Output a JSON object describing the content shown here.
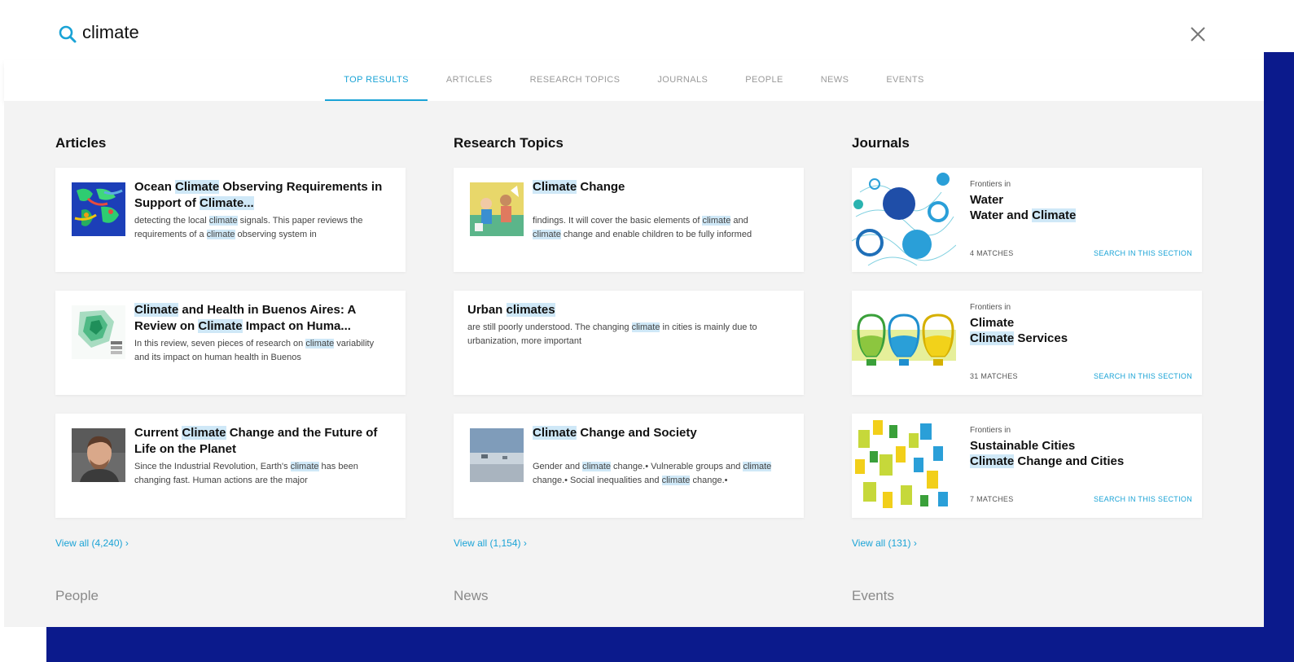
{
  "search": {
    "query": "climate"
  },
  "tabs": [
    {
      "label": "TOP RESULTS"
    },
    {
      "label": "ARTICLES"
    },
    {
      "label": "RESEARCH TOPICS"
    },
    {
      "label": "JOURNALS"
    },
    {
      "label": "PEOPLE"
    },
    {
      "label": "NEWS"
    },
    {
      "label": "EVENTS"
    }
  ],
  "active_tab": "TOP RESULTS",
  "articles": {
    "title": "Articles",
    "view_all": "View all (4,240) ›",
    "items": [
      {
        "title_parts": [
          "Ocean ",
          "Climate",
          " Observing Requirements in Support of ",
          "Climate..."
        ],
        "snippet_parts": [
          "detecting the local ",
          "climate",
          " signals. This paper reviews the requirements of a ",
          "climate",
          " observing system in"
        ]
      },
      {
        "title_parts": [
          "Climate",
          " and Health in Buenos Aires: A Review on ",
          "Climate",
          " Impact on Huma..."
        ],
        "snippet_parts": [
          "In this review, seven pieces of research on ",
          "climate",
          " variability and its impact on human health in Buenos"
        ]
      },
      {
        "title_parts": [
          "Current ",
          "Climate",
          " Change and the Future of Life on the Planet"
        ],
        "snippet_parts": [
          "Since the Industrial Revolution, Earth's ",
          "climate",
          " has been changing fast. Human actions are the major"
        ]
      }
    ]
  },
  "research_topics": {
    "title": "Research Topics",
    "view_all": "View all (1,154) ›",
    "items": [
      {
        "title_parts": [
          "Climate",
          " Change"
        ],
        "snippet_parts": [
          "findings. It will cover the basic elements of ",
          "climate",
          " and ",
          "climate",
          " change and enable children to be fully informed"
        ]
      },
      {
        "title_parts": [
          "Urban ",
          "climates"
        ],
        "snippet_parts": [
          "are still poorly understood. The changing ",
          "climate",
          " in cities is mainly due to urbanization, more important"
        ]
      },
      {
        "title_parts": [
          "Climate",
          " Change and Society"
        ],
        "snippet_parts": [
          "Gender and ",
          "climate",
          " change.• Vulnerable groups and ",
          "climate",
          " change.• Social inequalities and ",
          "climate",
          " change.•"
        ]
      }
    ]
  },
  "journals": {
    "title": "Journals",
    "view_all": "View all (131) ›",
    "search_section_label": "SEARCH IN THIS SECTION",
    "items": [
      {
        "frontiers_in": "Frontiers in",
        "subject": "Water",
        "name_parts": [
          "Water and ",
          "Climate"
        ],
        "matches": "4 MATCHES"
      },
      {
        "frontiers_in": "Frontiers in",
        "subject": "Climate",
        "name_parts": [
          "Climate",
          " Services"
        ],
        "matches": "31 MATCHES"
      },
      {
        "frontiers_in": "Frontiers in",
        "subject": "Sustainable Cities",
        "name_parts": [
          "Climate",
          " Change and Cities"
        ],
        "matches": "7 MATCHES"
      }
    ]
  },
  "sections_below": {
    "people": "People",
    "news": "News",
    "events": "Events"
  },
  "colors": {
    "accent": "#1aa3d6",
    "highlight": "#cfe8f7",
    "navy": "#0b1a8c",
    "background": "#f3f3f3"
  }
}
